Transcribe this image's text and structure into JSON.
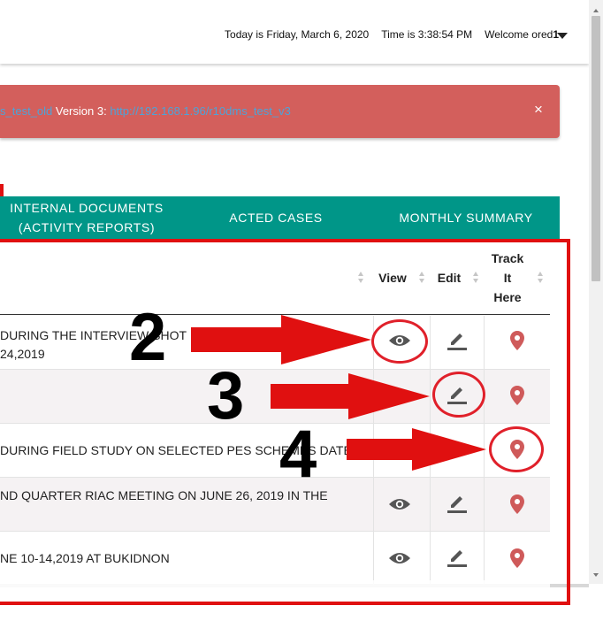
{
  "header": {
    "date_text": "Today is Friday, March 6, 2020",
    "time_text": "Time is 3:38:54 PM",
    "welcome_text": "Welcome ored",
    "welcome_suffix": "1"
  },
  "alert": {
    "link1": "s_test_old",
    "text": " Version 3: ",
    "link2": "http://192.168.1.96/r10dms_test_v3",
    "close": "×"
  },
  "tabs": {
    "internal_line1": "INTERNAL DOCUMENTS",
    "internal_line2": "(ACTIVITY REPORTS)",
    "acted": "ACTED CASES",
    "monthly": "MONTHLY SUMMARY"
  },
  "table": {
    "headers": {
      "view": "View",
      "edit": "Edit",
      "track": "Track It Here"
    },
    "rows": [
      {
        "description": " DURING THE INTERVIEW SHOT\n24,2019"
      },
      {
        "description": ""
      },
      {
        "description": " DURING FIELD STUDY ON SELECTED PES SCHEMES DATED"
      },
      {
        "description": "ND QUARTER RIAC MEETING ON JUNE 26, 2019 IN THE"
      },
      {
        "description": "NE 10-14,2019 AT BUKIDNON"
      }
    ]
  },
  "annotations": {
    "n2": "2",
    "n3": "3",
    "n4": "4"
  },
  "colors": {
    "teal": "#009688",
    "alert_red": "#d35f5c",
    "annotation_red": "#e01010",
    "pin_red": "#cf5a5a"
  }
}
